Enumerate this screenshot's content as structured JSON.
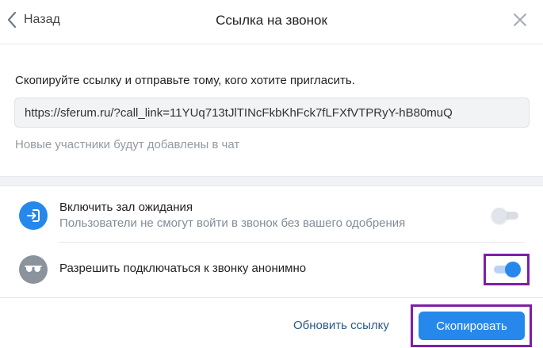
{
  "header": {
    "back_label": "Назад",
    "title": "Ссылка на звонок"
  },
  "link_section": {
    "instruction": "Скопируйте ссылку и отправьте тому, кого хотите пригласить.",
    "link": "https://sferum.ru/?call_link=11YUq713tJlTINcFkbKhFck7fLFXfVTPRyY-hB80muQ",
    "hint": "Новые участники будут добавлены в чат"
  },
  "settings": {
    "waiting_room": {
      "title": "Включить зал ожидания",
      "subtitle": "Пользователи не смогут войти в звонок без вашего одобрения",
      "enabled": false,
      "icon": "enter-door-icon"
    },
    "anonymous": {
      "title": "Разрешить подключаться к звонку анонимно",
      "enabled": true,
      "icon": "sunglasses-icon"
    }
  },
  "footer": {
    "refresh_label": "Обновить ссылку",
    "copy_label": "Скопировать"
  },
  "colors": {
    "accent": "#2688eb",
    "link_text": "#2a5885",
    "hint_text": "#939aa3",
    "highlight": "#7e1fa8"
  }
}
